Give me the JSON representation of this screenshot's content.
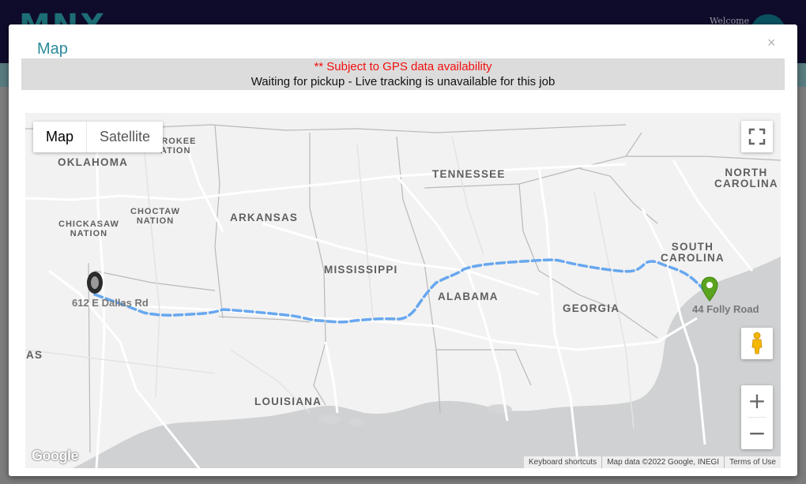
{
  "background": {
    "logo_text": "MNX",
    "welcome_text": "Welcome"
  },
  "modal": {
    "title": "Map",
    "close_glyph": "×",
    "notice_warning": "** Subject to GPS data availability",
    "notice_message": "Waiting for pickup - Live tracking is unavailable for this job"
  },
  "map": {
    "type_buttons": {
      "map": "Map",
      "satellite": "Satellite"
    },
    "labels": {
      "oklahoma": "OKLAHOMA",
      "cherokee": "EROKEE\nATION",
      "tennessee": "TENNESSEE",
      "north_carolina": "NORTH\nCAROLINA",
      "chickasaw": "CHICKASAW\nNATION",
      "choctaw": "CHOCTAW\nNATION",
      "arkansas": "ARKANSAS",
      "mississippi": "MISSISSIPPI",
      "alabama": "ALABAMA",
      "georgia": "GEORGIA",
      "south_carolina": "SOUTH\nCAROLINA",
      "texas_partial": "AS",
      "louisiana": "LOUISIANA"
    },
    "origin_label": "612 E Dallas Rd",
    "destination_label": "44 Folly Road",
    "controls": {
      "zoom_in": "+",
      "zoom_out": "−"
    },
    "google_logo": "Google",
    "attribution": {
      "shortcuts": "Keyboard shortcuts",
      "map_data": "Map data ©2022 Google, INEGI",
      "terms": "Terms of Use"
    },
    "icons": [
      "fullscreen-icon",
      "pegman-icon",
      "origin-marker-icon",
      "destination-marker-icon"
    ],
    "colors": {
      "route": "#67a7ef",
      "destination_pin": "#5aa41f",
      "origin_pin": "#2b2b2b",
      "water": "#cfd1d2"
    }
  }
}
